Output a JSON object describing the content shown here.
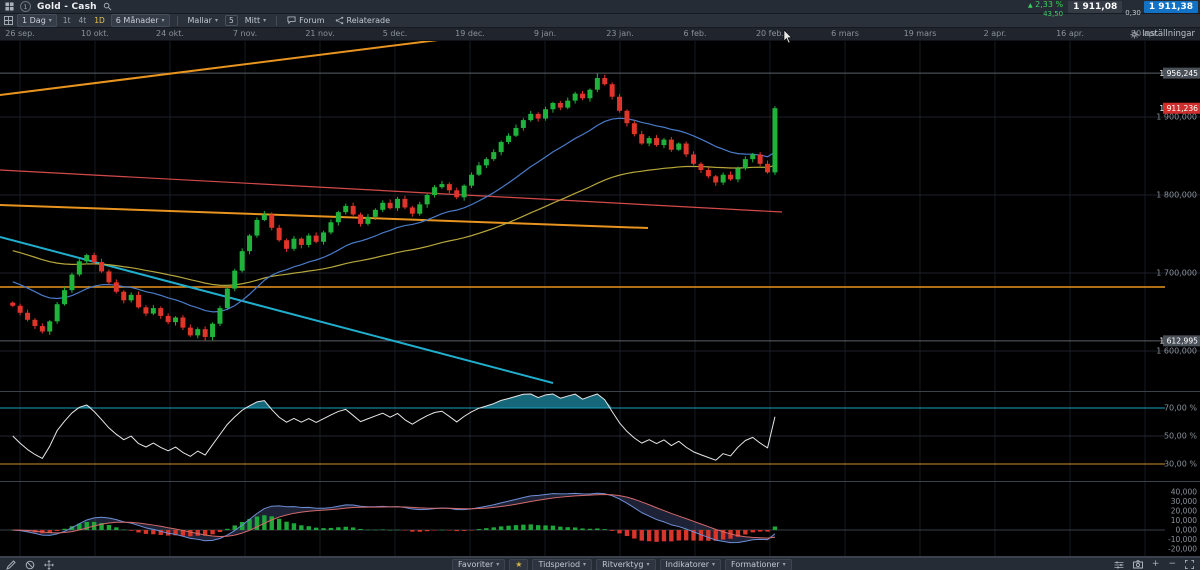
{
  "icons": {
    "change_up": "▲",
    "caret_down": "▾",
    "star": "★",
    "plus": "+",
    "minus": "−"
  },
  "header": {
    "chart_number": "1",
    "instrument": "Gold - Cash",
    "change_pct": "2,33 %",
    "change_points": "43,50",
    "sell_price": "1 911,08",
    "spread": "0,30",
    "buy_price": "1 911,38"
  },
  "toolbar": {
    "timeframe": "1 Dag",
    "quick_periods": [
      "1t",
      "4t",
      "1D"
    ],
    "active_quick_period": "1D",
    "range": "6 Månader",
    "templates": "Mallar",
    "template_count": "5",
    "mine": "Mitt",
    "forum": "Forum",
    "related": "Relaterade",
    "settings": "Inställningar"
  },
  "bottom_bar": {
    "favorites_label": "Favoriter",
    "buttons": [
      "Tidsperiod",
      "Ritverktyg",
      "Indikatorer",
      "Formationer"
    ]
  },
  "axes": {
    "dates": [
      "26 sep.",
      "10 okt.",
      "24 okt.",
      "7 nov.",
      "21 nov.",
      "5 dec.",
      "19 dec.",
      "9 jan.",
      "23 jan.",
      "6 feb.",
      "20 feb.",
      "6 mars",
      "19 mars",
      "2 apr.",
      "16 apr.",
      "30 apr."
    ],
    "price_labels": [
      "1 900,000",
      "1 800,000",
      "1 700,000",
      "1 600,000"
    ],
    "price_values": [
      1900,
      1800,
      1700,
      1600
    ],
    "rsi_labels": [
      "70,00 %",
      "50,00 %",
      "30,00 %"
    ],
    "rsi_values": [
      70,
      50,
      30
    ],
    "macd_labels": [
      "40,000",
      "30,000",
      "20,000",
      "10,000",
      "0,000",
      "-10,000",
      "-20,000"
    ],
    "macd_values": [
      40,
      30,
      20,
      10,
      0,
      -10,
      -20
    ],
    "badges": {
      "current_price": "1 911,236",
      "period_high": "1 956,245",
      "period_low": "1 612,995"
    }
  },
  "colors": {
    "candle_up": "#1fb33c",
    "candle_down": "#e0352b",
    "ma_blue": "#4a7bc8",
    "ma_yellow": "#b7a63c",
    "trend_orange": "#e8941f",
    "trend_cyan": "#21aecd",
    "trend_red": "#d44a4a",
    "rsi_line": "#e6e6e6",
    "rsi_line70": "#1e9fc0",
    "rsi_line30": "#cf9030",
    "rsi_over_fill": "#17677a",
    "rsi_under_fill": "#a3741f",
    "macd_line": "#6e8fd6",
    "macd_signal": "#d46a6a",
    "hist_up": "#1fa83a",
    "hist_down": "#d8352b",
    "badge_red": "#cf2e2e",
    "badge_grey": "#4a5058",
    "buy_blue": "#1472c4",
    "change_green": "#3ad05f"
  },
  "chart_data": {
    "type": "candlestick",
    "title": "Gold - Cash, 1 Dag, 6 Månader",
    "open_rule": "previous close",
    "closes": [
      1658,
      1649,
      1640,
      1632,
      1625,
      1638,
      1660,
      1678,
      1698,
      1715,
      1723,
      1714,
      1702,
      1688,
      1676,
      1665,
      1672,
      1656,
      1648,
      1655,
      1645,
      1637,
      1643,
      1630,
      1620,
      1628,
      1618,
      1635,
      1655,
      1680,
      1703,
      1728,
      1748,
      1768,
      1775,
      1758,
      1742,
      1731,
      1744,
      1736,
      1748,
      1740,
      1752,
      1765,
      1778,
      1786,
      1775,
      1763,
      1772,
      1781,
      1790,
      1783,
      1795,
      1784,
      1776,
      1788,
      1800,
      1810,
      1814,
      1806,
      1797,
      1812,
      1826,
      1838,
      1846,
      1855,
      1868,
      1876,
      1886,
      1896,
      1904,
      1898,
      1910,
      1918,
      1912,
      1921,
      1930,
      1924,
      1935,
      1950,
      1942,
      1926,
      1908,
      1892,
      1878,
      1866,
      1873,
      1864,
      1871,
      1858,
      1866,
      1852,
      1840,
      1832,
      1824,
      1816,
      1826,
      1820,
      1834,
      1846,
      1852,
      1840,
      1829,
      1911.24
    ],
    "wick_overrides": {
      "26": {
        "low": 1612.995
      },
      "79": {
        "high": 1956.245
      }
    },
    "last_price": 1911.236,
    "period_high_value": 1956.245,
    "period_low_value": 1612.995,
    "price_range_approx": [
      1560,
      1998
    ],
    "indicators": {
      "rsi_period": 14,
      "macd_periods": [
        12,
        26,
        9
      ],
      "ema_blue": {
        "period": 20,
        "seed": 1692
      },
      "ema_yellow": {
        "period": 60,
        "seed": 1731
      }
    },
    "drawings": [
      {
        "name": "trendline-rising-orange",
        "color_key": "trend_orange",
        "width": 2,
        "points": [
          [
            0,
            55
          ],
          [
            486,
            -6
          ]
        ]
      },
      {
        "name": "trendline-falling-orange",
        "color_key": "trend_orange",
        "width": 2,
        "points": [
          [
            0,
            165
          ],
          [
            648,
            188
          ]
        ]
      },
      {
        "name": "horizontal-level-orange",
        "color_key": "trend_orange",
        "width": 1.5,
        "points": [
          [
            0,
            247
          ],
          [
            1165,
            247
          ]
        ]
      },
      {
        "name": "trendline-falling-cyan",
        "color_key": "trend_cyan",
        "width": 2,
        "points": [
          [
            0,
            197
          ],
          [
            553,
            343
          ]
        ]
      },
      {
        "name": "trendline-falling-red",
        "color_key": "trend_red",
        "width": 1.2,
        "points": [
          [
            0,
            130
          ],
          [
            782,
            172
          ]
        ]
      }
    ]
  }
}
